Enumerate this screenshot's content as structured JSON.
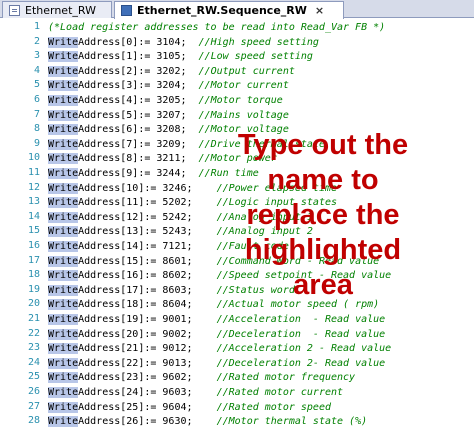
{
  "tabs": [
    {
      "label": "Ethernet_RW",
      "active": false
    },
    {
      "label": "Ethernet_RW.Sequence_RW",
      "active": true,
      "close": "×"
    }
  ],
  "lines": [
    {
      "n": "1",
      "kw": "",
      "rest": "",
      "comment": "(*Load register addresses to be read into Read_Var FB *)"
    },
    {
      "n": "2",
      "kw": "Write",
      "rest": "Address[0]:= 3104;  ",
      "comment": "//High speed setting"
    },
    {
      "n": "3",
      "kw": "Write",
      "rest": "Address[1]:= 3105;  ",
      "comment": "//Low speed setting"
    },
    {
      "n": "4",
      "kw": "Write",
      "rest": "Address[2]:= 3202;  ",
      "comment": "//Output current"
    },
    {
      "n": "5",
      "kw": "Write",
      "rest": "Address[3]:= 3204;  ",
      "comment": "//Motor current"
    },
    {
      "n": "6",
      "kw": "Write",
      "rest": "Address[4]:= 3205;  ",
      "comment": "//Motor torque"
    },
    {
      "n": "7",
      "kw": "Write",
      "rest": "Address[5]:= 3207;  ",
      "comment": "//Mains voltage"
    },
    {
      "n": "8",
      "kw": "Write",
      "rest": "Address[6]:= 3208;  ",
      "comment": "//Motor voltage"
    },
    {
      "n": "9",
      "kw": "Write",
      "rest": "Address[7]:= 3209;  ",
      "comment": "//Drive thermal state"
    },
    {
      "n": "10",
      "kw": "Write",
      "rest": "Address[8]:= 3211;  ",
      "comment": "//Motor power"
    },
    {
      "n": "11",
      "kw": "Write",
      "rest": "Address[9]:= 3244;  ",
      "comment": "//Run time"
    },
    {
      "n": "12",
      "kw": "Write",
      "rest": "Address[10]:= 3246;    ",
      "comment": "//Power elapsed time"
    },
    {
      "n": "13",
      "kw": "Write",
      "rest": "Address[11]:= 5202;    ",
      "comment": "//Logic input states"
    },
    {
      "n": "14",
      "kw": "Write",
      "rest": "Address[12]:= 5242;    ",
      "comment": "//Analog input 1"
    },
    {
      "n": "15",
      "kw": "Write",
      "rest": "Address[13]:= 5243;    ",
      "comment": "//Analog input 2"
    },
    {
      "n": "16",
      "kw": "Write",
      "rest": "Address[14]:= 7121;    ",
      "comment": "//Fault code"
    },
    {
      "n": "17",
      "kw": "Write",
      "rest": "Address[15]:= 8601;    ",
      "comment": "//Command Word - Read value"
    },
    {
      "n": "18",
      "kw": "Write",
      "rest": "Address[16]:= 8602;    ",
      "comment": "//Speed setpoint - Read value"
    },
    {
      "n": "19",
      "kw": "Write",
      "rest": "Address[17]:= 8603;    ",
      "comment": "//Status word"
    },
    {
      "n": "20",
      "kw": "Write",
      "rest": "Address[18]:= 8604;    ",
      "comment": "//Actual motor speed ( rpm)"
    },
    {
      "n": "21",
      "kw": "Write",
      "rest": "Address[19]:= 9001;    ",
      "comment": "//Acceleration  - Read value"
    },
    {
      "n": "22",
      "kw": "Write",
      "rest": "Address[20]:= 9002;    ",
      "comment": "//Deceleration  - Read value"
    },
    {
      "n": "23",
      "kw": "Write",
      "rest": "Address[21]:= 9012;    ",
      "comment": "//Acceleration 2 - Read value"
    },
    {
      "n": "24",
      "kw": "Write",
      "rest": "Address[22]:= 9013;    ",
      "comment": "//Deceleration 2- Read value"
    },
    {
      "n": "25",
      "kw": "Write",
      "rest": "Address[23]:= 9602;    ",
      "comment": "//Rated motor frequency"
    },
    {
      "n": "26",
      "kw": "Write",
      "rest": "Address[24]:= 9603;    ",
      "comment": "//Rated motor current"
    },
    {
      "n": "27",
      "kw": "Write",
      "rest": "Address[25]:= 9604;    ",
      "comment": "//Rated motor speed"
    },
    {
      "n": "28",
      "kw": "Write",
      "rest": "Address[26]:= 9630;    ",
      "comment": "//Motor thermal state (%)"
    }
  ],
  "overlay": {
    "text": "Type out the name to replace the highlighted area",
    "color": "#c00000"
  },
  "colors": {
    "comment": "#008000",
    "line_number": "#2b91af",
    "highlight": "#b8c6e8",
    "annotation": "#c00000"
  },
  "icons": [
    "document-icon",
    "function-block-icon",
    "close-icon"
  ]
}
